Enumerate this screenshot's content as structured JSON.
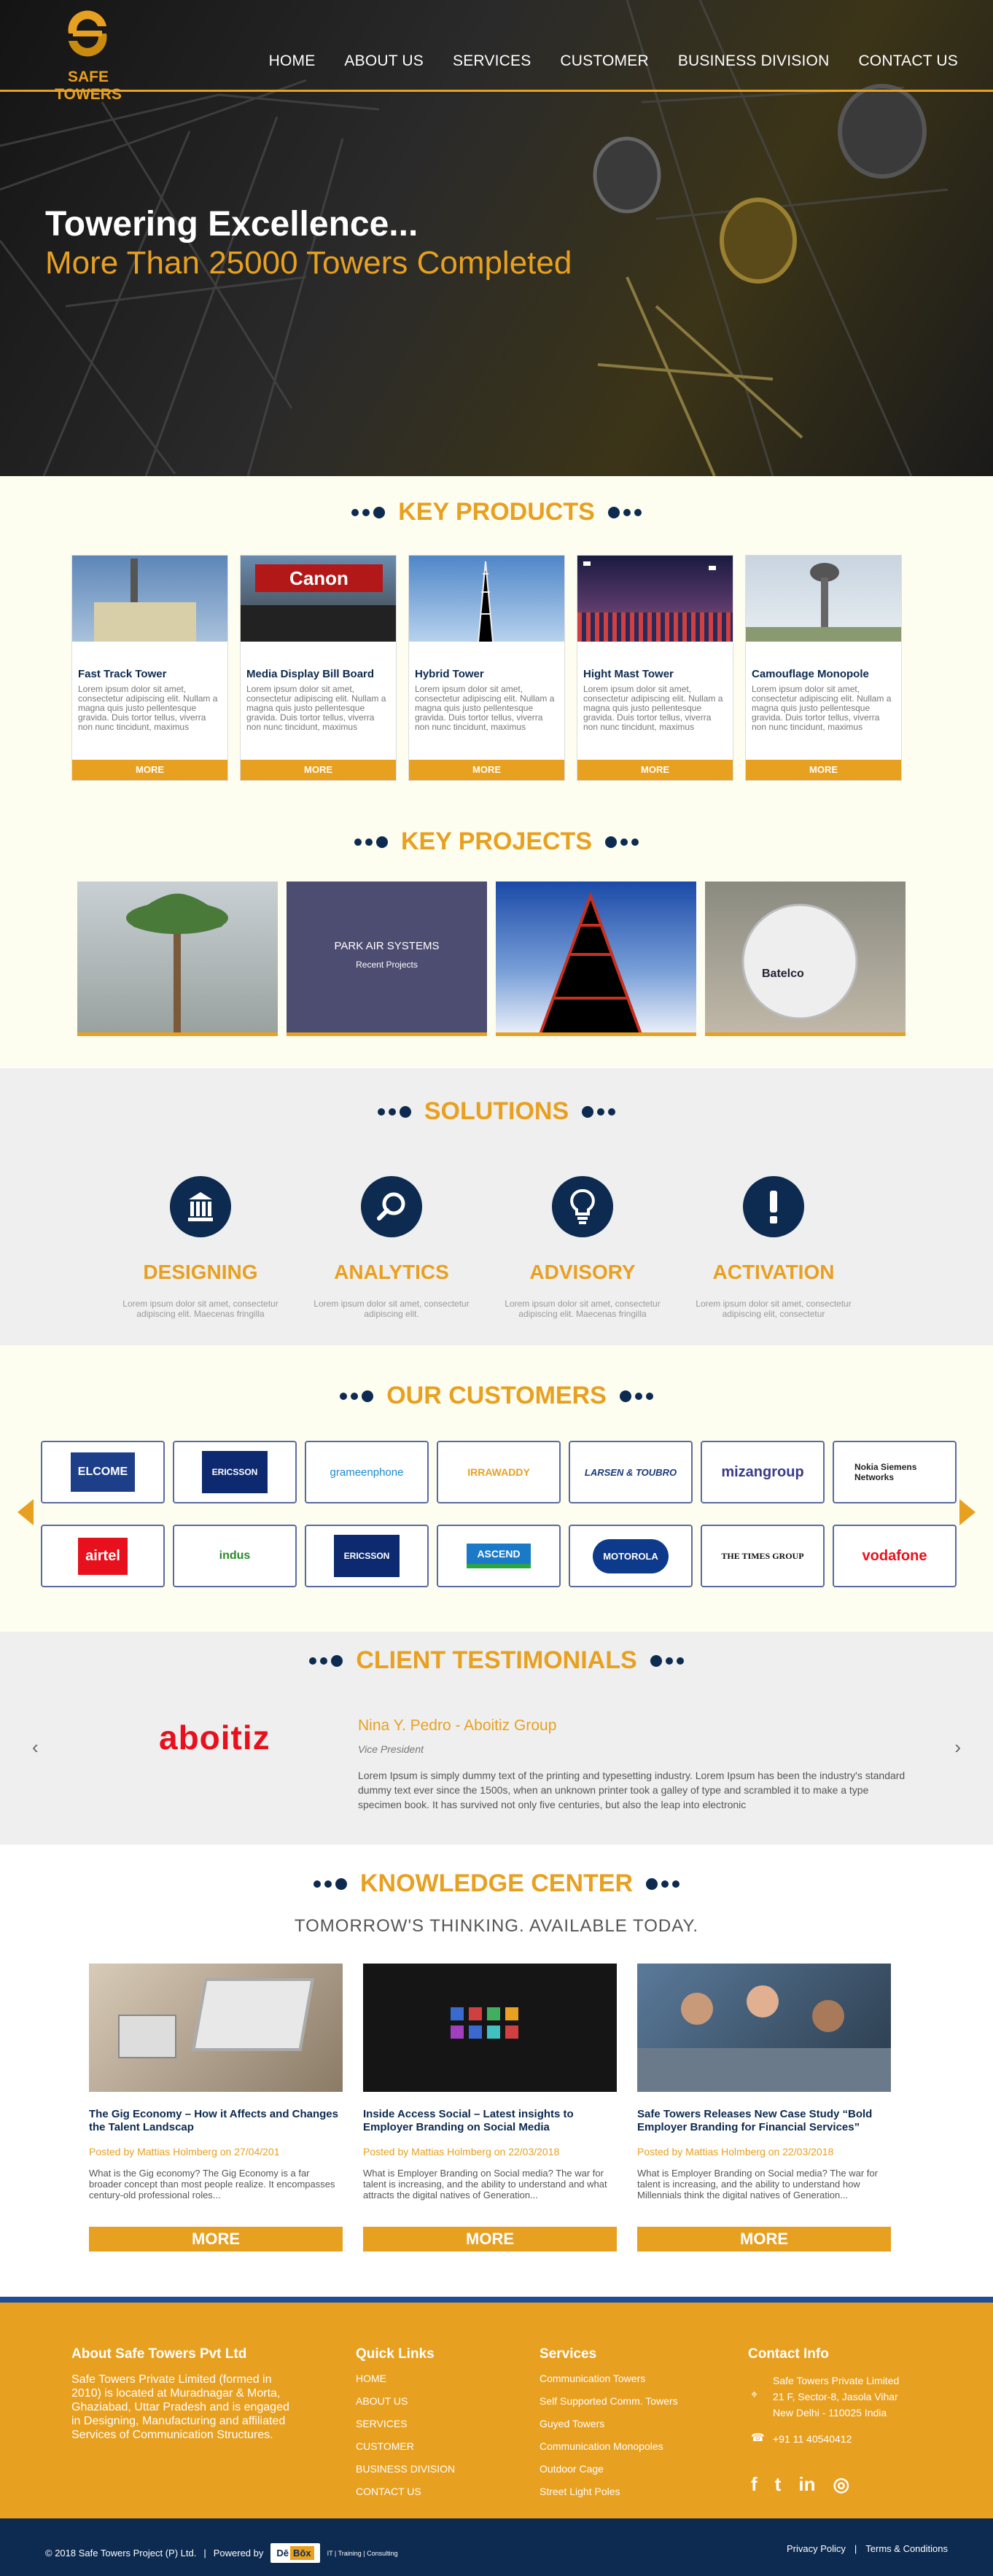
{
  "brand": {
    "name": "SAFE TOWERS"
  },
  "nav": [
    "HOME",
    "ABOUT US",
    "SERVICES",
    "CUSTOMER",
    "BUSINESS DIVISION",
    "CONTACT US"
  ],
  "hero": {
    "line1": "Towering Excellence...",
    "line2": "More Than 25000 Towers Completed"
  },
  "products": {
    "title": "KEY PRODUCTS",
    "more": "MORE",
    "items": [
      {
        "name": "Fast Track Tower",
        "text": "Lorem ipsum dolor sit amet, consectetur adipiscing elit. Nullam a magna quis justo pellentesque gravida. Duis tortor tellus, viverra non nunc tincidunt, maximus elementum justo..."
      },
      {
        "name": "Media Display Bill Board",
        "text": "Lorem ipsum dolor sit amet, consectetur adipiscing elit. Nullam a magna quis justo pellentesque gravida. Duis tortor tellus, viverra non nunc tincidunt, maximus elementum justo..."
      },
      {
        "name": "Hybrid Tower",
        "text": "Lorem ipsum dolor sit amet, consectetur adipiscing elit. Nullam a magna quis justo pellentesque gravida. Duis tortor tellus, viverra non nunc tincidunt, maximus elementum justo..."
      },
      {
        "name": "Hight Mast Tower",
        "text": "Lorem ipsum dolor sit amet, consectetur adipiscing elit. Nullam a magna quis justo pellentesque gravida. Duis tortor tellus, viverra non nunc tincidunt, maximus elementum justo..."
      },
      {
        "name": "Camouflage Monopole",
        "text": "Lorem ipsum dolor sit amet, consectetur adipiscing elit. Nullam a magna quis justo pellentesque gravida. Duis tortor tellus, viverra non nunc tincidunt, maximus elementum justo..."
      }
    ],
    "image_labels": {
      "canon": "Canon"
    }
  },
  "projects": {
    "title": "KEY PROJECTS",
    "overlay_title": "PARK AIR SYSTEMS",
    "overlay_sub": "Recent Projects",
    "sphere_label": "Batelco"
  },
  "solutions": {
    "title": "SOLUTIONS",
    "items": [
      {
        "name": "DESIGNING",
        "text": "Lorem ipsum dolor sit amet, consectetur adipiscing elit. Maecenas fringilla",
        "icon": "bank-icon"
      },
      {
        "name": "ANALYTICS",
        "text": "Lorem ipsum dolor sit amet, consectetur adipiscing elit.",
        "icon": "search-icon"
      },
      {
        "name": "ADVISORY",
        "text": "Lorem ipsum dolor sit amet, consectetur adipiscing elit. Maecenas fringilla",
        "icon": "lightbulb-icon"
      },
      {
        "name": "ACTIVATION",
        "text": "Lorem ipsum dolor sit amet, consectetur adipiscing elit, consectetur",
        "icon": "exclamation-icon"
      }
    ]
  },
  "customers": {
    "title": "OUR CUSTOMERS",
    "logos": [
      "ELCOME",
      "ERICSSON",
      "grameenphone",
      "IRRAWADDY",
      "LARSEN & TOUBRO",
      "mizangroup",
      "Nokia Siemens Networks",
      "airtel",
      "indus",
      "ERICSSON",
      "ASCEND",
      "MOTOROLA",
      "THE TIMES GROUP",
      "vodafone"
    ]
  },
  "testimonials": {
    "title": "CLIENT TESTIMONIALS",
    "logo": "aboitiz",
    "name": "Nina Y. Pedro - Aboitiz Group",
    "role": "Vice President",
    "text": "Lorem Ipsum is simply dummy text of the printing and typesetting industry. Lorem Ipsum has been the industry's standard dummy text ever since the 1500s, when an unknown printer took a galley of type and scrambled it to make a type specimen book. It has survived not only five centuries, but also the leap into electronic",
    "prev": "‹",
    "next": "›"
  },
  "knowledge": {
    "title": "KNOWLEDGE CENTER",
    "tagline": "TOMORROW'S THINKING. AVAILABLE TODAY.",
    "more": "MORE",
    "items": [
      {
        "title": "The Gig Economy – How it Affects and Changes the Talent Landscap",
        "posted": "Posted by Mattias Holmberg on 27/04/201",
        "text": "What is the Gig economy? The Gig Economy is a far broader concept than most people realize. It encompasses century-old professional roles..."
      },
      {
        "title": "Inside Access Social – Latest insights to Employer Branding on Social Media",
        "posted": "Posted by Mattias Holmberg on 22/03/2018",
        "text": "What is Employer Branding on Social media? The war for talent is increasing, and the ability to understand and what attracts the digital natives of Generation..."
      },
      {
        "title": "Safe Towers Releases New Case Study “Bold Employer Branding for Financial Services”",
        "posted": "Posted by Mattias Holmberg on 22/03/2018",
        "text": "What is Employer Branding on Social media? The war for talent is increasing, and the ability to understand how Millennials think the digital natives of Generation..."
      }
    ]
  },
  "footer": {
    "about_title": "About Safe Towers Pvt Ltd",
    "about_text": "Safe Towers Private Limited (formed in 2010) is located at Muradnagar & Morta, Ghaziabad, Uttar Pradesh and is engaged in Designing, Manufacturing and affiliated Services of Communication Structures.",
    "links_title": "Quick Links",
    "links": [
      "HOME",
      "ABOUT US",
      "SERVICES",
      "CUSTOMER",
      "BUSINESS DIVISION",
      "CONTACT US"
    ],
    "services_title": "Services",
    "services": [
      "Communication Towers",
      "Self Supported Comm. Towers",
      "Guyed Towers",
      "Communication Monopoles",
      "Outdoor Cage",
      "Street Light Poles"
    ],
    "contact_title": "Contact Info",
    "address": [
      "Safe Towers Private Limited",
      "21 F, Sector-8, Jasola Vihar",
      "New Delhi - 110025 India"
    ],
    "phone": "+91 11 40540412",
    "copyright": "© 2018 Safe Towers Project (P) Ltd.",
    "powered": "Powered by",
    "powered_brand_a": "Dē",
    "powered_brand_b": "Bōx",
    "powered_sub": "IT | Training | Consulting",
    "privacy": "Privacy Policy",
    "sep": "|",
    "terms": "Terms & Conditions"
  },
  "colors": {
    "accent": "#e8a020",
    "navy": "#0d2a50",
    "cream": "#fdfdf0"
  }
}
